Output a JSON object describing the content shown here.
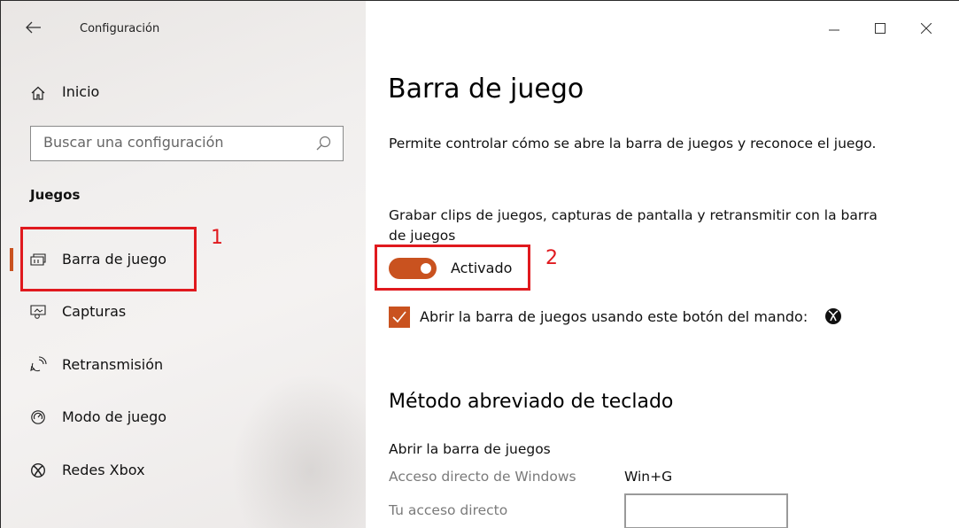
{
  "window": {
    "title": "Configuración",
    "controls": {
      "minimize": "—",
      "maximize": "☐",
      "close": "✕"
    }
  },
  "sidebar": {
    "home_label": "Inicio",
    "search_placeholder": "Buscar una configuración",
    "section_title": "Juegos",
    "items": [
      {
        "label": "Barra de juego",
        "icon": "game-bar-icon",
        "active": true
      },
      {
        "label": "Capturas",
        "icon": "captures-icon",
        "active": false
      },
      {
        "label": "Retransmisión",
        "icon": "broadcast-icon",
        "active": false
      },
      {
        "label": "Modo de juego",
        "icon": "game-mode-icon",
        "active": false
      },
      {
        "label": "Redes Xbox",
        "icon": "xbox-icon",
        "active": false
      }
    ]
  },
  "main": {
    "title": "Barra de juego",
    "description": "Permite controlar cómo se abre la barra de juegos y reconoce el juego.",
    "record_description": "Grabar clips de juegos, capturas de pantalla y retransmitir con la barra de juegos",
    "toggle": {
      "state": "on",
      "label": "Activado"
    },
    "checkbox": {
      "checked": true,
      "label": "Abrir la barra de juegos usando este botón del mando:"
    },
    "shortcut_section_title": "Método abreviado de teclado",
    "shortcut_header": "Abrir la barra de juegos",
    "windows_shortcut_label": "Acceso directo de Windows",
    "windows_shortcut_value": "Win+G",
    "custom_shortcut_label": "Tu acceso directo",
    "custom_shortcut_value": ""
  },
  "annotations": {
    "box1_number": "1",
    "box2_number": "2",
    "color": "#e0191e"
  },
  "colors": {
    "accent": "#c9521f",
    "sidebar_bg": "#f1efee"
  }
}
